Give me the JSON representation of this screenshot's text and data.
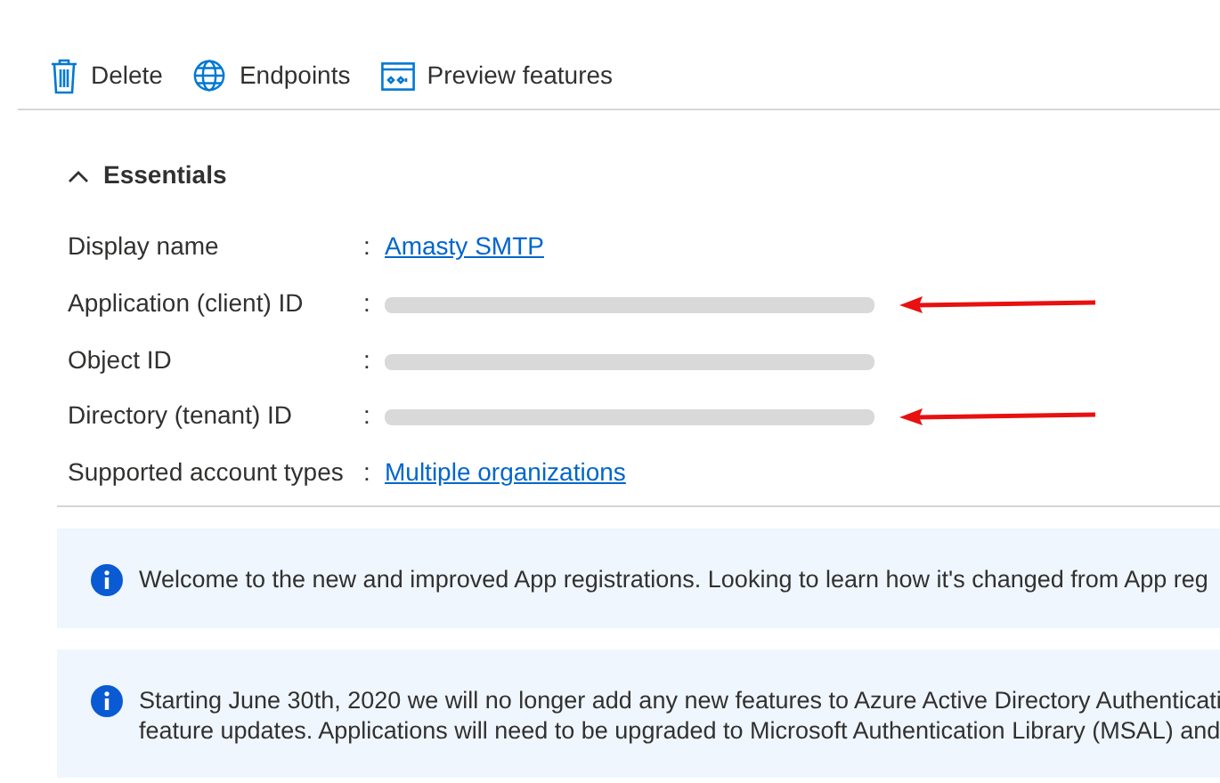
{
  "toolbar": [
    {
      "kind": "delete",
      "label": "Delete"
    },
    {
      "kind": "endpoints",
      "label": "Endpoints"
    },
    {
      "kind": "preview",
      "label": "Preview features"
    }
  ],
  "essentials": {
    "title": "Essentials",
    "expanded": true,
    "rows": [
      {
        "label": "Display name",
        "separator": ":",
        "value": "Amasty SMTP",
        "kind": "link",
        "arrow": false
      },
      {
        "label": "Application (client) ID",
        "separator": ":",
        "kind": "redacted",
        "arrow": true
      },
      {
        "label": "Object ID",
        "separator": ":",
        "kind": "redacted",
        "arrow": false
      },
      {
        "label": "Directory (tenant) ID",
        "separator": ":",
        "kind": "redacted",
        "arrow": true
      },
      {
        "label": "Supported account types",
        "separator": ":",
        "value": "Multiple organizations",
        "kind": "link",
        "arrow": false
      }
    ]
  },
  "banners": [
    {
      "lines": [
        "Welcome to the new and improved App registrations. Looking to learn how it's changed from App reg"
      ]
    },
    {
      "lines": [
        "Starting June 30th, 2020 we will no longer add any new features to Azure Active Directory Authenticati",
        "feature updates. Applications will need to be upgraded to Microsoft Authentication Library (MSAL) and"
      ]
    }
  ]
}
